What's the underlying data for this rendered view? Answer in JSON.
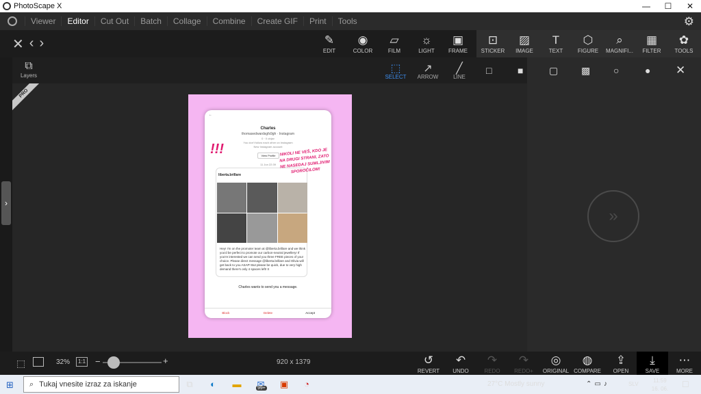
{
  "window": {
    "title": "PhotoScape X",
    "minimize": "—",
    "maximize": "☐",
    "close": "✕"
  },
  "menu": {
    "items": [
      "Viewer",
      "Editor",
      "Cut Out",
      "Batch",
      "Collage",
      "Combine",
      "Create GIF",
      "Print",
      "Tools"
    ],
    "active": "Editor"
  },
  "toolbar": {
    "tools": [
      {
        "label": "EDIT",
        "icon": "edit-icon"
      },
      {
        "label": "COLOR",
        "icon": "color-icon"
      },
      {
        "label": "FILM",
        "icon": "film-icon"
      },
      {
        "label": "LIGHT",
        "icon": "light-icon"
      },
      {
        "label": "FRAME",
        "icon": "frame-icon"
      },
      {
        "label": "STICKER",
        "icon": "sticker-icon"
      },
      {
        "label": "IMAGE",
        "icon": "image-icon"
      },
      {
        "label": "TEXT",
        "icon": "text-icon"
      },
      {
        "label": "FIGURE",
        "icon": "figure-icon"
      },
      {
        "label": "MAGNIFI...",
        "icon": "magnifier-icon"
      },
      {
        "label": "FILTER",
        "icon": "filter-icon"
      },
      {
        "label": "TOOLS",
        "icon": "tools-icon"
      }
    ]
  },
  "left_panel": {
    "layers_label": "Layers",
    "pro_badge": "PRO"
  },
  "subtools": [
    {
      "label": "SELECT",
      "active": true
    },
    {
      "label": "ARROW",
      "active": false
    },
    {
      "label": "LINE",
      "active": false
    }
  ],
  "phone": {
    "name": "Charles",
    "subtitle": "thomasedwardsgfs9gh · Instagram",
    "followers": "0 · 0 objav",
    "follow_note": "You don't follow each other on Instagram",
    "new_account": "New Instagram account",
    "view_profile": "View Profile",
    "date": "11 Jun 22:39",
    "card_name": "liberta.brillare",
    "message": "Hey! I'm on the promoter team at @liberta.brillare and we think you'd be perfect to promote our carbon-neutral jewellery! If you're interested we can send you three FREE pieces of your choice. Please direct message @liberta.brillare and Olivia will get back to you ASAP! But please be quick, due to very high demand there's only 4 spaces left! X",
    "wants": "Charles wants to send you a message.",
    "footer": [
      "Block",
      "Delete",
      "Accept"
    ],
    "bangs": "!!!",
    "warning": "NIKOLI NE VEŠ, KDO JE NA DRUGI STRANI, ZATO NE NASEDAJ SUMLJIVIM SPOROČILOM!"
  },
  "bottom": {
    "zoom": "32%",
    "one_to_one": "1:1",
    "minus": "−",
    "plus": "+",
    "zoom_level": 0.12,
    "dimensions": "920 x 1379",
    "actions": [
      {
        "label": "REVERT",
        "icon": "revert-icon",
        "enabled": true
      },
      {
        "label": "UNDO",
        "icon": "undo-icon",
        "enabled": true
      },
      {
        "label": "REDO",
        "icon": "redo-icon",
        "enabled": false
      },
      {
        "label": "REDO+",
        "icon": "redo-plus-icon",
        "enabled": false
      },
      {
        "label": "ORIGINAL",
        "icon": "original-icon",
        "enabled": true
      },
      {
        "label": "COMPARE",
        "icon": "compare-icon",
        "enabled": true
      },
      {
        "label": "OPEN",
        "icon": "open-icon",
        "enabled": true
      },
      {
        "label": "SAVE",
        "icon": "save-icon",
        "enabled": true
      },
      {
        "label": "MORE",
        "icon": "more-icon",
        "enabled": true
      }
    ]
  },
  "taskbar": {
    "search_placeholder": "Tukaj vnesite izraz za iskanje",
    "badge": "99+",
    "weather": "27°C  Mostly sunny",
    "language": "SLV",
    "time": "11:59",
    "date": "16. 06. 2022"
  }
}
